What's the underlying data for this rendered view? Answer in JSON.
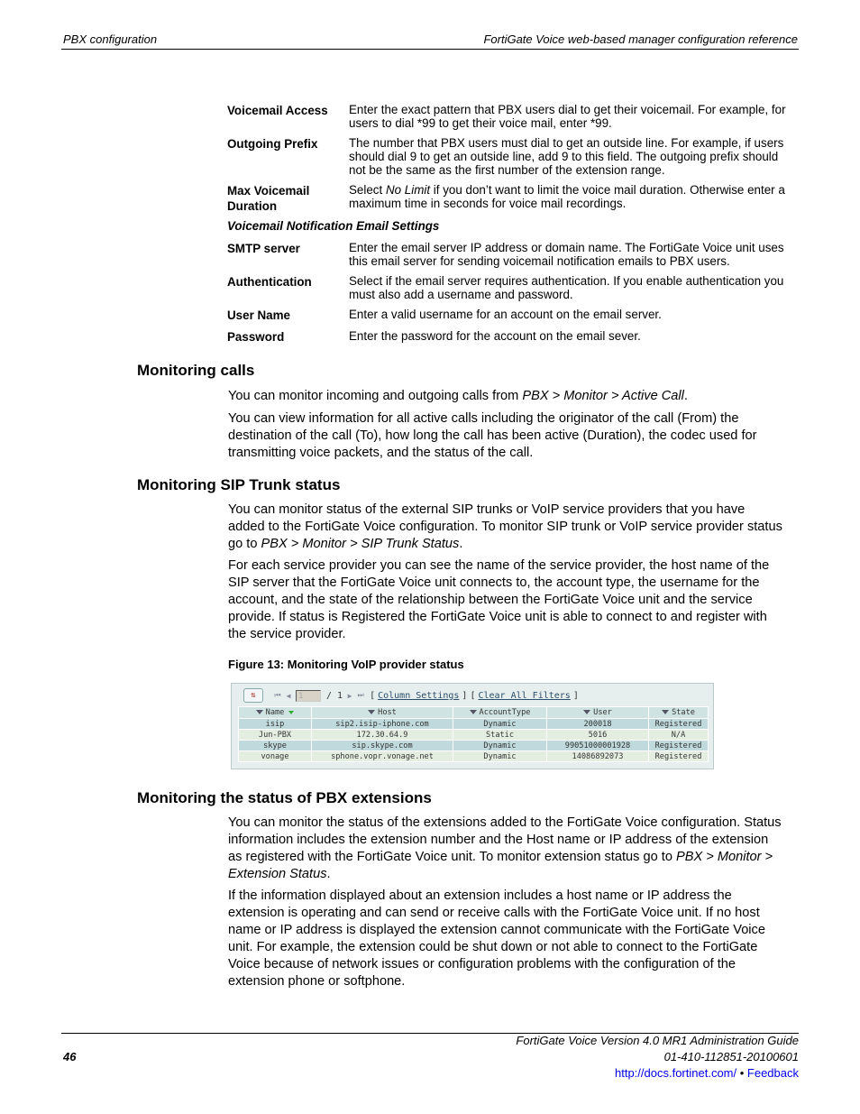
{
  "header": {
    "left": "PBX configuration",
    "right": "FortiGate Voice web-based manager configuration reference"
  },
  "definitions": [
    {
      "term": "Voicemail Access",
      "desc": "Enter the exact pattern that PBX users dial to get their voicemail. For example, for users to dial *99 to get their voice mail, enter *99."
    },
    {
      "term": "Outgoing Prefix",
      "desc": "The number that PBX users must dial to get an outside line. For example, if users should dial 9 to get an outside line, add 9 to this field. The outgoing prefix should not be the same as the first number of the extension range."
    },
    {
      "term": "Max Voicemail Duration",
      "desc_pre": "Select ",
      "desc_em": "No Limit",
      "desc_post": " if you don’t want to limit the voice mail duration. Otherwise enter a maximum time in seconds for voice mail recordings."
    },
    {
      "subheading": "Voicemail Notification Email Settings"
    },
    {
      "term": "SMTP server",
      "desc": "Enter the email server IP address or domain name. The FortiGate Voice unit uses this email server for sending voicemail notification emails to PBX users."
    },
    {
      "term": "Authentication",
      "desc": "Select if the email server requires authentication. If you enable authentication you must also add a username and password."
    },
    {
      "term": "User Name",
      "desc": "Enter a valid username for an account on the email server."
    },
    {
      "term": "Password",
      "desc": "Enter the password for the account on the email sever."
    }
  ],
  "sections": {
    "calls": {
      "heading": "Monitoring calls",
      "p1_pre": "You can monitor incoming and outgoing calls from ",
      "p1_path": "PBX > Monitor > Active Call",
      "p1_post": ".",
      "p2": "You can view information for all active calls including the originator of the call (From) the destination of the call (To), how long the call has been active (Duration), the codec used for transmitting voice packets, and the status of the call."
    },
    "sip": {
      "heading": "Monitoring SIP Trunk status",
      "p1_pre": "You can monitor status of the external SIP trunks or VoIP service providers that you have added to the FortiGate Voice configuration. To monitor SIP trunk or VoIP service provider status go to ",
      "p1_path": "PBX > Monitor > SIP Trunk Status",
      "p1_post": ".",
      "p2": "For each service provider you can see the name of the service provider, the host name of the SIP server that the FortiGate Voice unit connects to, the account type, the username for the account, and the state of the relationship between the FortiGate Voice unit and the service provide. If status is Registered the FortiGate Voice unit is able to connect to and register with the service provider.",
      "figure_caption": "Figure 13: Monitoring VoIP provider status"
    },
    "ext": {
      "heading": "Monitoring the status of PBX extensions",
      "p1_pre": "You can monitor the status of the extensions added to the FortiGate Voice configuration. Status information includes the extension number and the Host name or IP address of the extension as registered with the FortiGate Voice unit. To monitor extension status go to ",
      "p1_path": "PBX > Monitor > Extension Status",
      "p1_post": ".",
      "p2": "If the information displayed about an extension includes a host name or IP address the extension is operating and can send or receive calls with the FortiGate Voice unit. If no host name or IP address is displayed the extension cannot communicate with the FortiGate Voice unit. For example, the extension could be shut down or not able to connect to the FortiGate Voice because of network issues or configuration problems with the configuration of the extension phone or softphone."
    }
  },
  "figure": {
    "toolbar": {
      "page_value": "1",
      "page_total": "/ 1",
      "column_settings": "Column Settings",
      "clear_filters": "Clear All Filters",
      "bracket_open": "[",
      "bracket_close": "]"
    },
    "columns": [
      "Name",
      "Host",
      "AccountType",
      "User",
      "State"
    ],
    "rows": [
      [
        "isip",
        "sip2.isip-iphone.com",
        "Dynamic",
        "200018",
        "Registered"
      ],
      [
        "Jun-PBX",
        "172.30.64.9",
        "Static",
        "5016",
        "N/A"
      ],
      [
        "skype",
        "sip.skype.com",
        "Dynamic",
        "99051000001928",
        "Registered"
      ],
      [
        "vonage",
        "sphone.vopr.vonage.net",
        "Dynamic",
        "14086892073",
        "Registered"
      ]
    ]
  },
  "footer": {
    "page_number": "46",
    "line1": "FortiGate Voice Version 4.0 MR1 Administration Guide",
    "line2": "01-410-112851-20100601",
    "link": "http://docs.fortinet.com/",
    "bullet": " • ",
    "feedback": "Feedback"
  }
}
